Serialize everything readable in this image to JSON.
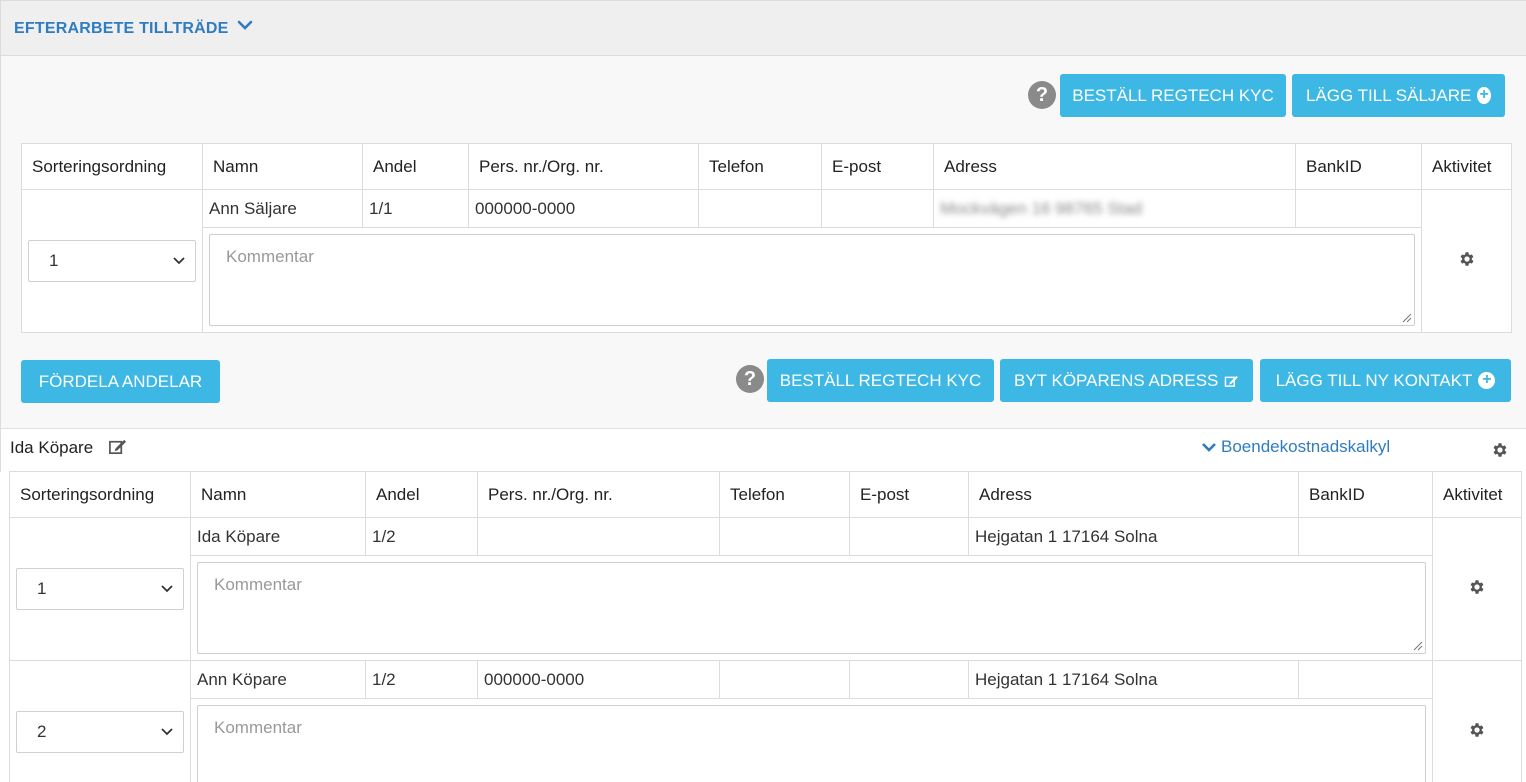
{
  "section": {
    "title": "EFTERARBETE TILLTRÄDE",
    "collapse_icon": "chevron-down-icon"
  },
  "sellers": {
    "buttons": {
      "kyc": "BESTÄLL REGTECH KYC",
      "add_seller": "LÄGG TILL SÄLJARE"
    },
    "help_glyph": "?",
    "columns": [
      "Sorteringsordning",
      "Namn",
      "Andel",
      "Pers. nr./Org. nr.",
      "Telefon",
      "E-post",
      "Adress",
      "BankID",
      "Aktivitet"
    ],
    "rows": [
      {
        "sort": "1",
        "name": "Ann Säljare",
        "share": "1/1",
        "pnr": "000000-0000",
        "phone": "",
        "email": "",
        "address": "Mockvägen 16 98765 Stad",
        "bankid": "",
        "comment_placeholder": "Kommentar"
      }
    ]
  },
  "buyers": {
    "buttons": {
      "distribute": "FÖRDELA ANDELAR",
      "kyc": "BESTÄLL REGTECH KYC",
      "change_address": "BYT KÖPARENS ADRESS",
      "add_contact": "LÄGG TILL NY KONTAKT"
    },
    "help_glyph": "?",
    "header_name": "Ida Köpare",
    "calc_link": "Boendekostnadskalkyl",
    "columns": [
      "Sorteringsordning",
      "Namn",
      "Andel",
      "Pers. nr./Org. nr.",
      "Telefon",
      "E-post",
      "Adress",
      "BankID",
      "Aktivitet"
    ],
    "rows": [
      {
        "sort": "1",
        "name": "Ida Köpare",
        "share": "1/2",
        "pnr": "",
        "phone": "",
        "email": "",
        "address": "Hejgatan 1 17164 Solna",
        "bankid": "",
        "comment_placeholder": "Kommentar"
      },
      {
        "sort": "2",
        "name": "Ann Köpare",
        "share": "1/2",
        "pnr": "000000-0000",
        "phone": "",
        "email": "",
        "address": "Hejgatan 1 17164 Solna",
        "bankid": "",
        "comment_placeholder": "Kommentar"
      }
    ]
  },
  "colors": {
    "accent": "#3db7e4",
    "link": "#2f7cc0",
    "help": "#8a8a8a"
  }
}
